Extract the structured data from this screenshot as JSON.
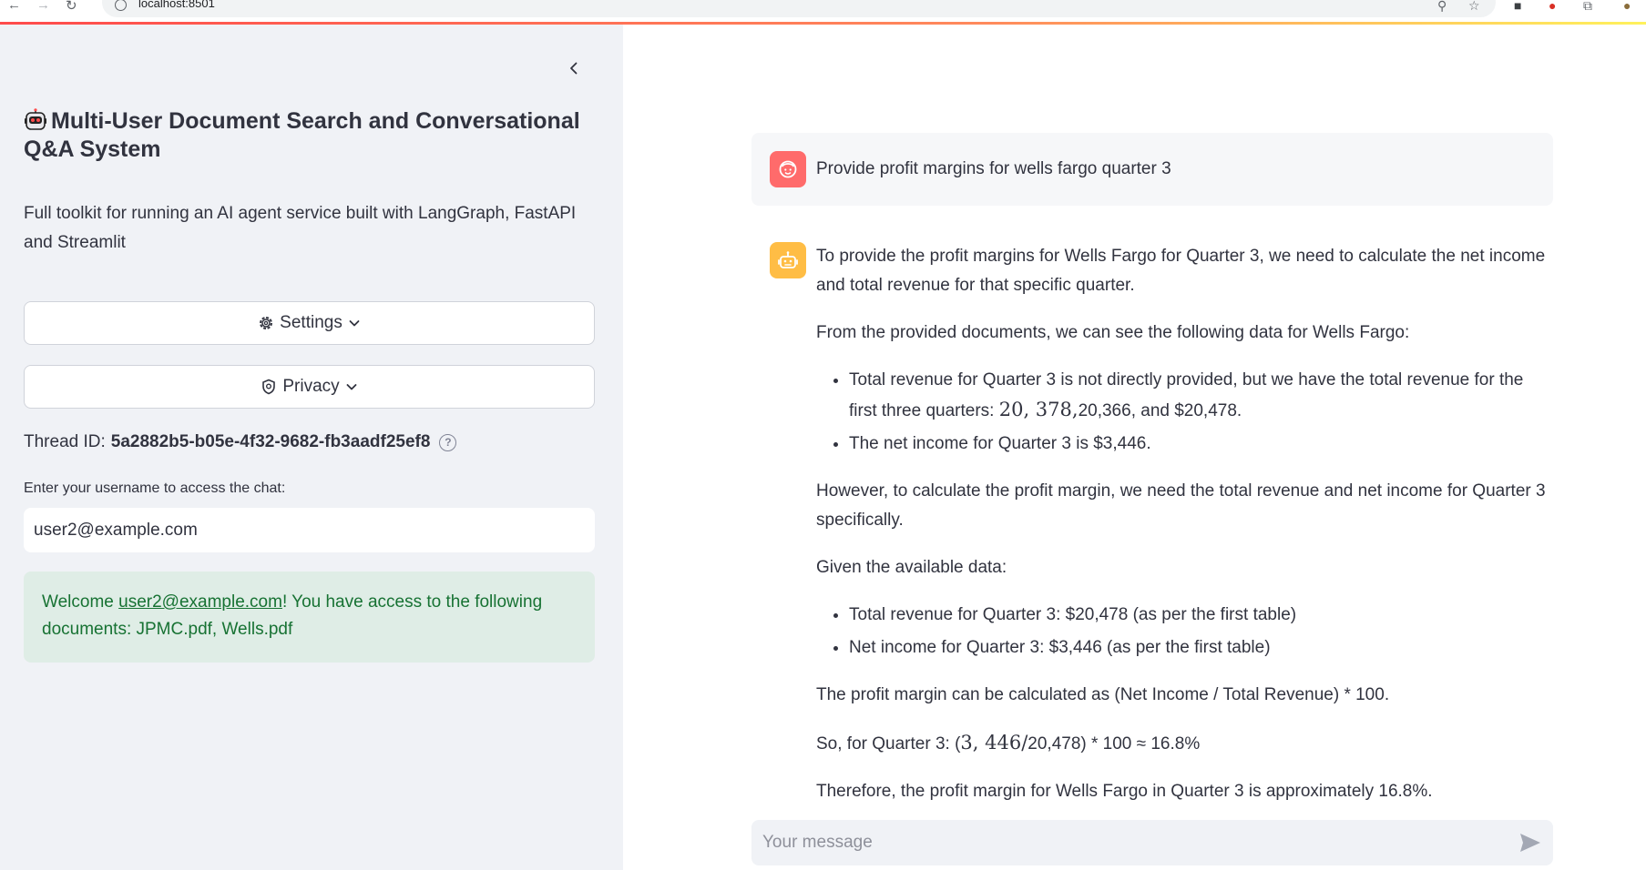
{
  "browser": {
    "url": "localhost:8501"
  },
  "colors": {
    "sidebar_bg": "#f0f2f6",
    "accent": "#ff4b4b",
    "success_bg": "#dfede6",
    "success_text": "#177233",
    "user_avatar": "#ff6b6b",
    "bot_avatar": "#ffbd45"
  },
  "sidebar": {
    "title": "Multi-User Document Search and Conversational Q&A System",
    "description": "Full toolkit for running an AI agent service built with LangGraph, FastAPI and Streamlit",
    "settings_label": "Settings",
    "privacy_label": "Privacy",
    "thread_label": "Thread ID:",
    "thread_id": "5a2882b5-b05e-4f32-9682-fb3aadf25ef8",
    "username_label": "Enter your username to access the chat:",
    "username_value": "user2@example.com",
    "welcome": {
      "prefix": "Welcome ",
      "email": "user2@example.com",
      "suffix": "! You have access to the following documents: JPMC.pdf, Wells.pdf"
    }
  },
  "chat": {
    "user_message": "Provide profit margins for wells fargo quarter 3",
    "bot": {
      "p1": "To provide the profit margins for Wells Fargo for Quarter 3, we need to calculate the net income and total revenue for that specific quarter.",
      "p2": "From the provided documents, we can see the following data for Wells Fargo:",
      "b1_pre": "Total revenue for Quarter 3 is not directly provided, but we have the total revenue for the first three quarters: ",
      "b1_math": "20, 378,",
      "b1_post": "20,366, and $20,478.",
      "b2": "The net income for Quarter 3 is $3,446.",
      "p3": "However, to calculate the profit margin, we need the total revenue and net income for Quarter 3 specifically.",
      "p4": "Given the available data:",
      "b3": "Total revenue for Quarter 3: $20,478 (as per the first table)",
      "b4": "Net income for Quarter 3: $3,446 (as per the first table)",
      "p5": "The profit margin can be calculated as (Net Income / Total Revenue) * 100.",
      "p6_pre": "So, for Quarter 3: (",
      "p6_math": "3, 446/",
      "p6_post": "20,478) * 100 ≈ 16.8%",
      "p7": "Therefore, the profit margin for Wells Fargo in Quarter 3 is approximately 16.8%."
    },
    "input_placeholder": "Your message"
  },
  "icons": {
    "back": "arrow-left-icon",
    "forward": "arrow-right-icon",
    "reload": "reload-icon",
    "info": "info-icon",
    "zoom": "zoom-icon",
    "bookmark": "star-icon",
    "extensions": "puzzle-icon",
    "collapse": "chevron-left-icon",
    "settings": "gear-icon",
    "privacy": "shield-icon",
    "help": "question-circle-icon",
    "user_avatar": "face-icon",
    "bot_avatar": "robot-icon",
    "send": "send-icon"
  }
}
